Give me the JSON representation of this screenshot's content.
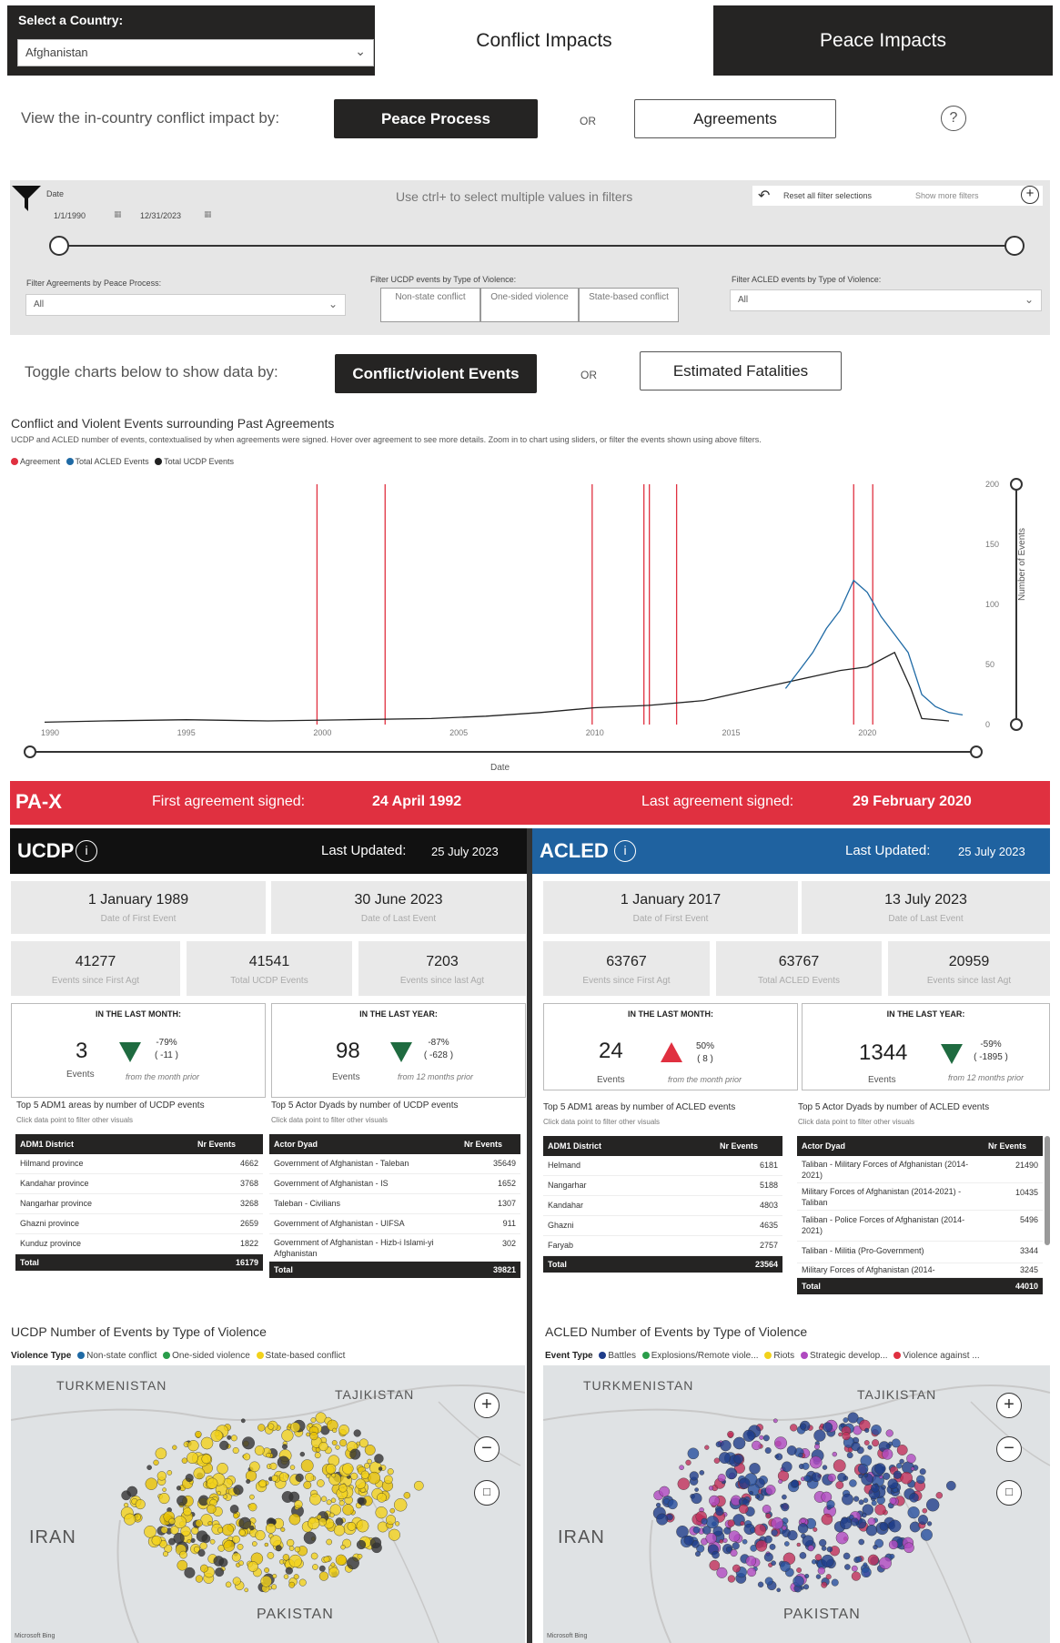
{
  "header": {
    "country_label": "Select a Country:",
    "country_value": "Afghanistan",
    "tab_conflict": "Conflict Impacts",
    "tab_peace": "Peace Impacts"
  },
  "view_by": {
    "label": "View the in-country conflict impact by:",
    "btn_peace_process": "Peace Process",
    "or": "OR",
    "btn_agreements": "Agreements",
    "help_icon": "?"
  },
  "filters": {
    "date_label": "Date",
    "date_start": "1/1/1990",
    "date_end": "12/31/2023",
    "hint": "Use ctrl+ to select multiple values in filters",
    "reset_label": "Reset all filter selections",
    "show_more": "Show more filters",
    "peace_process_label": "Filter Agreements by Peace Process:",
    "peace_process_value": "All",
    "ucdp_type_label": "Filter UCDP events by Type of Violence:",
    "ucdp_types": [
      "Non-state conflict",
      "One-sided violence",
      "State-based conflict"
    ],
    "acled_type_label": "Filter ACLED events by Type of Violence:",
    "acled_type_value": "All"
  },
  "toggle": {
    "label": "Toggle charts below to show data by:",
    "btn_events": "Conflict/violent Events",
    "or": "OR",
    "btn_fatalities": "Estimated Fatalities"
  },
  "chart_data": {
    "type": "line",
    "title": "Conflict and Violent Events surrounding Past Agreements",
    "subtitle": "UCDP and ACLED number of events, contextualised by when agreements were signed. Hover over agreement to see more details. Zoom in to chart using sliders, or filter the events shown using above filters.",
    "xlabel": "Date",
    "ylabel": "Number of Events",
    "x_ticks": [
      "1990",
      "1995",
      "2000",
      "2005",
      "2010",
      "2015",
      "2020"
    ],
    "y_ticks": [
      0,
      50,
      100,
      150,
      200
    ],
    "ylim": [
      0,
      200
    ],
    "xlim": [
      1989.8,
      2023.6
    ],
    "series": [
      {
        "name": "Agreement",
        "color": "#e03040",
        "agreement_years": [
          1999.8,
          2002.3,
          2009.9,
          2011.8,
          2012.0,
          2013.0,
          2019.5,
          2020.2
        ]
      },
      {
        "name": "Total ACLED Events",
        "color": "#1f6aa5",
        "x": [
          2017.0,
          2017.5,
          2018.0,
          2018.5,
          2019.0,
          2019.5,
          2020.0,
          2020.5,
          2021.0,
          2021.5,
          2022.0,
          2022.5,
          2023.0,
          2023.5
        ],
        "values": [
          30,
          45,
          60,
          80,
          95,
          120,
          110,
          90,
          75,
          60,
          25,
          15,
          10,
          8
        ]
      },
      {
        "name": "Total UCDP Events",
        "color": "#222222",
        "x": [
          1989.8,
          1992,
          1995,
          1998,
          2001,
          2004,
          2006,
          2008,
          2010,
          2012,
          2014,
          2016,
          2018,
          2019,
          2020,
          2021,
          2021.6,
          2022,
          2023
        ],
        "values": [
          2,
          3,
          4,
          3,
          4,
          5,
          7,
          10,
          14,
          16,
          20,
          30,
          40,
          45,
          48,
          60,
          30,
          5,
          3
        ]
      }
    ],
    "legend": "top-left"
  },
  "pax": {
    "logo": "PA-X",
    "first_label": "First agreement signed:",
    "first_date": "24 April 1992",
    "last_label": "Last agreement signed:",
    "last_date": "29 February 2020"
  },
  "ucdp": {
    "logo": "UCDP",
    "info": "i",
    "last_updated_label": "Last Updated:",
    "last_updated": "25 July 2023",
    "date_first": "1 January 1989",
    "date_first_label": "Date of First Event",
    "date_last": "30 June 2023",
    "date_last_label": "Date of Last Event",
    "events_first_agr": "41277",
    "events_first_agr_label": "Events since First Agt",
    "total_events": "41541",
    "total_events_label": "Total UCDP Events",
    "events_last_agr": "7203",
    "events_last_agr_label": "Events since last Agt",
    "month_title": "IN THE LAST MONTH:",
    "month_events": "3",
    "month_pct": "-79%",
    "month_diff": "( -11 )",
    "month_from": "from the month prior",
    "year_title": "IN THE LAST YEAR:",
    "year_events": "98",
    "year_pct": "-87%",
    "year_diff": "( -628 )",
    "year_from": "from 12 months prior",
    "events_label": "Events",
    "adm_title": "Top 5 ADM1 areas by number of UCDP events",
    "adm_sub": "Click data point to filter other visuals",
    "adm_headers": [
      "ADM1 District",
      "Nr Events"
    ],
    "adm_rows": [
      [
        "Hilmand province",
        "4662"
      ],
      [
        "Kandahar province",
        "3768"
      ],
      [
        "Nangarhar province",
        "3268"
      ],
      [
        "Ghazni province",
        "2659"
      ],
      [
        "Kunduz province",
        "1822"
      ]
    ],
    "adm_total": [
      "Total",
      "16179"
    ],
    "dyad_title": "Top 5 Actor Dyads by number of UCDP events",
    "dyad_sub": "Click data point to filter other visuals",
    "dyad_headers": [
      "Actor Dyad",
      "Nr Events"
    ],
    "dyad_rows": [
      [
        "Government of Afghanistan - Taleban",
        "35649"
      ],
      [
        "Government of Afghanistan - IS",
        "1652"
      ],
      [
        "Taleban - Civilians",
        "1307"
      ],
      [
        "Government of Afghanistan - UIFSA",
        "911"
      ],
      [
        "Government of Afghanistan - Hizb-i Islami-yi Afghanistan",
        "302"
      ]
    ],
    "dyad_total": [
      "Total",
      "39821"
    ],
    "map_title": "UCDP Number of Events by Type of Violence",
    "legend_title": "Violence Type",
    "legend_items": [
      "Non-state conflict",
      "One-sided violence",
      "State-based conflict"
    ],
    "legend_colors": [
      "#1f6aa5",
      "#2a9d4a",
      "#f2d21b"
    ]
  },
  "acled": {
    "logo": "ACLED",
    "info": "i",
    "last_updated_label": "Last Updated:",
    "last_updated": "25 July 2023",
    "date_first": "1 January 2017",
    "date_first_label": "Date of First Event",
    "date_last": "13 July 2023",
    "date_last_label": "Date of Last Event",
    "events_first_agr": "63767",
    "events_first_agr_label": "Events since First Agt",
    "total_events": "63767",
    "total_events_label": "Total ACLED Events",
    "events_last_agr": "20959",
    "events_last_agr_label": "Events since last Agt",
    "month_title": "IN THE LAST MONTH:",
    "month_events": "24",
    "month_pct": "50%",
    "month_diff": "( 8 )",
    "month_from": "from the month prior",
    "year_title": "IN THE LAST YEAR:",
    "year_events": "1344",
    "year_pct": "-59%",
    "year_diff": "( -1895 )",
    "year_from": "from 12 months prior",
    "events_label": "Events",
    "adm_title": "Top 5 ADM1 areas by number of ACLED events",
    "adm_sub": "Click data point to filter other visuals",
    "adm_headers": [
      "ADM1 District",
      "Nr Events"
    ],
    "adm_rows": [
      [
        "Helmand",
        "6181"
      ],
      [
        "Nangarhar",
        "5188"
      ],
      [
        "Kandahar",
        "4803"
      ],
      [
        "Ghazni",
        "4635"
      ],
      [
        "Faryab",
        "2757"
      ]
    ],
    "adm_total": [
      "Total",
      "23564"
    ],
    "dyad_title": "Top 5 Actor Dyads by number of ACLED events",
    "dyad_sub": "Click data point to filter other visuals",
    "dyad_headers": [
      "Actor Dyad",
      "Nr Events"
    ],
    "dyad_rows": [
      [
        "Taliban - Military Forces of Afghanistan (2014-2021)",
        "21490"
      ],
      [
        "Military Forces of Afghanistan (2014-2021) - Taliban",
        "10435"
      ],
      [
        "Taliban - Police Forces of Afghanistan (2014-2021)",
        "5496"
      ],
      [
        "Taliban - Militia (Pro-Government)",
        "3344"
      ],
      [
        "Military Forces of Afghanistan (2014-",
        "3245"
      ]
    ],
    "dyad_total": [
      "Total",
      "44010"
    ],
    "map_title": "ACLED Number of Events by Type of Violence",
    "legend_title": "Event Type",
    "legend_items": [
      "Battles",
      "Explosions/Remote viole...",
      "Riots",
      "Strategic develop...",
      "Violence against ..."
    ],
    "legend_colors": [
      "#1f3d8a",
      "#2a9d4a",
      "#f2d21b",
      "#b04ac0",
      "#e03040"
    ]
  },
  "maps": {
    "turkmenistan": "TURKMENISTAN",
    "tajikistan": "TAJIKISTAN",
    "iran": "IRAN",
    "pakistan": "PAKISTAN",
    "bing": "Microsoft Bing"
  }
}
